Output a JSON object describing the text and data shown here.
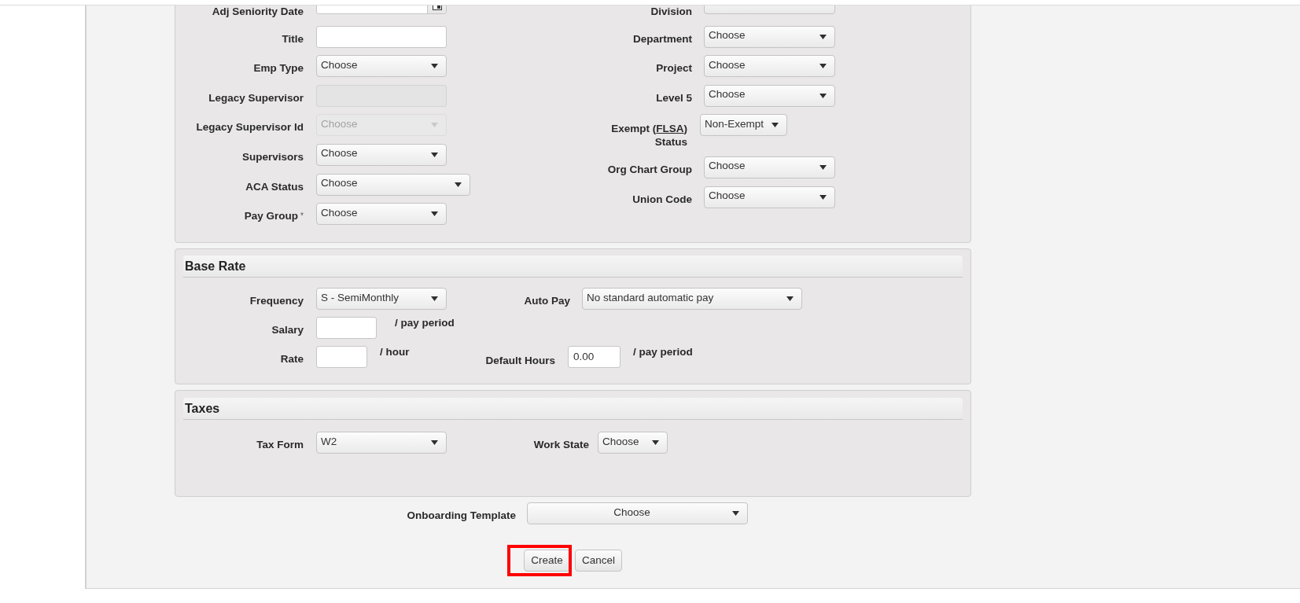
{
  "employment": {
    "left_fields": [
      {
        "kind": "date",
        "label": "Adj Seniority Date",
        "disabled": false
      },
      {
        "kind": "text",
        "label": "Title",
        "disabled": false
      },
      {
        "kind": "select",
        "label": "Emp Type",
        "value": "Choose",
        "disabled": false
      },
      {
        "kind": "text",
        "label": "Legacy Supervisor",
        "disabled": true
      },
      {
        "kind": "select",
        "label": "Legacy Supervisor Id",
        "value": "Choose",
        "disabled": true
      },
      {
        "kind": "select",
        "label": "Supervisors",
        "value": "Choose",
        "disabled": false
      },
      {
        "kind": "wide_select",
        "label": "ACA Status",
        "value": "Choose",
        "disabled": false
      },
      {
        "kind": "select",
        "label": "Pay Group",
        "required_mark": "*",
        "value": "Choose",
        "disabled": false
      }
    ],
    "right_fields": [
      {
        "kind": "select",
        "label": "Division"
      },
      {
        "kind": "select",
        "label": "Department",
        "value": "Choose"
      },
      {
        "kind": "select",
        "label": "Project",
        "value": "Choose"
      },
      {
        "kind": "select",
        "label": "Level 5",
        "value": "Choose"
      },
      {
        "kind": "compact_select",
        "label": "Exempt (",
        "abbreviation": "FLSA",
        "label_after": ") Status",
        "value": "Non-Exempt"
      },
      {
        "kind": "select",
        "label": "Org Chart Group",
        "value": "Choose"
      },
      {
        "kind": "select",
        "label": "Union Code",
        "value": "Choose"
      }
    ]
  },
  "base_rate": {
    "title": "Base Rate",
    "frequency": {
      "label": "Frequency",
      "value": "S - SemiMonthly"
    },
    "auto_pay": {
      "label": "Auto Pay",
      "value": "No standard automatic pay"
    },
    "salary": {
      "label": "Salary",
      "unit": "/ pay period"
    },
    "rate": {
      "label": "Rate",
      "unit": "/ hour"
    },
    "default_hours": {
      "label": "Default Hours",
      "value": "0.00",
      "unit": "/ pay period"
    }
  },
  "taxes": {
    "title": "Taxes",
    "tax_form": {
      "label": "Tax Form",
      "value": "W2"
    },
    "work_state": {
      "label": "Work State",
      "value": "Choose"
    }
  },
  "onboarding_template": {
    "label": "Onboarding Template",
    "value": "Choose"
  },
  "buttons": [
    {
      "label": "Create",
      "highlighted": true
    },
    {
      "label": "Cancel",
      "highlighted": false
    }
  ]
}
